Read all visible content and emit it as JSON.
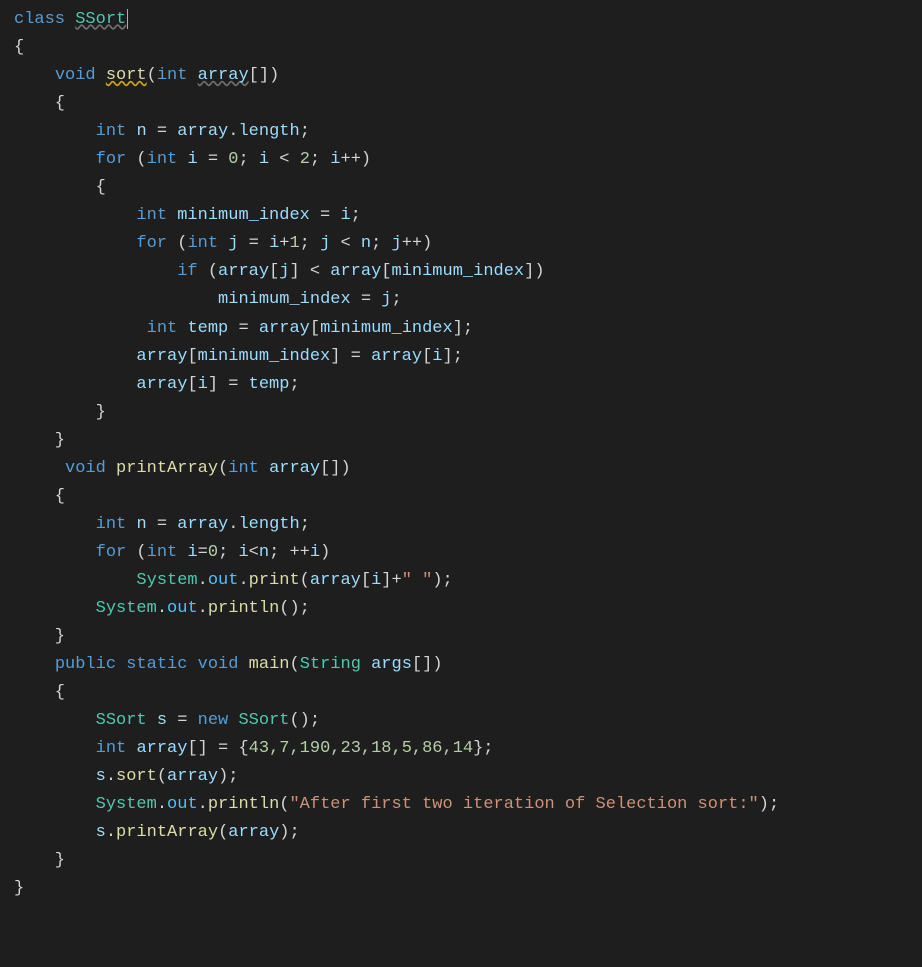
{
  "code": {
    "class_kw": "class",
    "class_name": "SSort",
    "void_kw": "void",
    "int_kw": "int",
    "for_kw": "for",
    "if_kw": "if",
    "public_kw": "public",
    "static_kw": "static",
    "new_kw": "new",
    "sort_name": "sort",
    "printArray_name": "printArray",
    "main_name": "main",
    "array_var": "array",
    "n_var": "n",
    "i_var": "i",
    "j_var": "j",
    "minimum_index_var": "minimum_index",
    "temp_var": "temp",
    "s_var": "s",
    "args_var": "args",
    "length_prop": "length",
    "System_name": "System",
    "out_prop": "out",
    "print_name": "print",
    "println_name": "println",
    "String_type": "String",
    "num_0": "0",
    "num_1": "1",
    "num_2": "2",
    "arr_literal": "43,7,190,23,18,5,86,14",
    "str_space": "\" \"",
    "str_msg": "\"After first two iteration of Selection sort:\""
  }
}
